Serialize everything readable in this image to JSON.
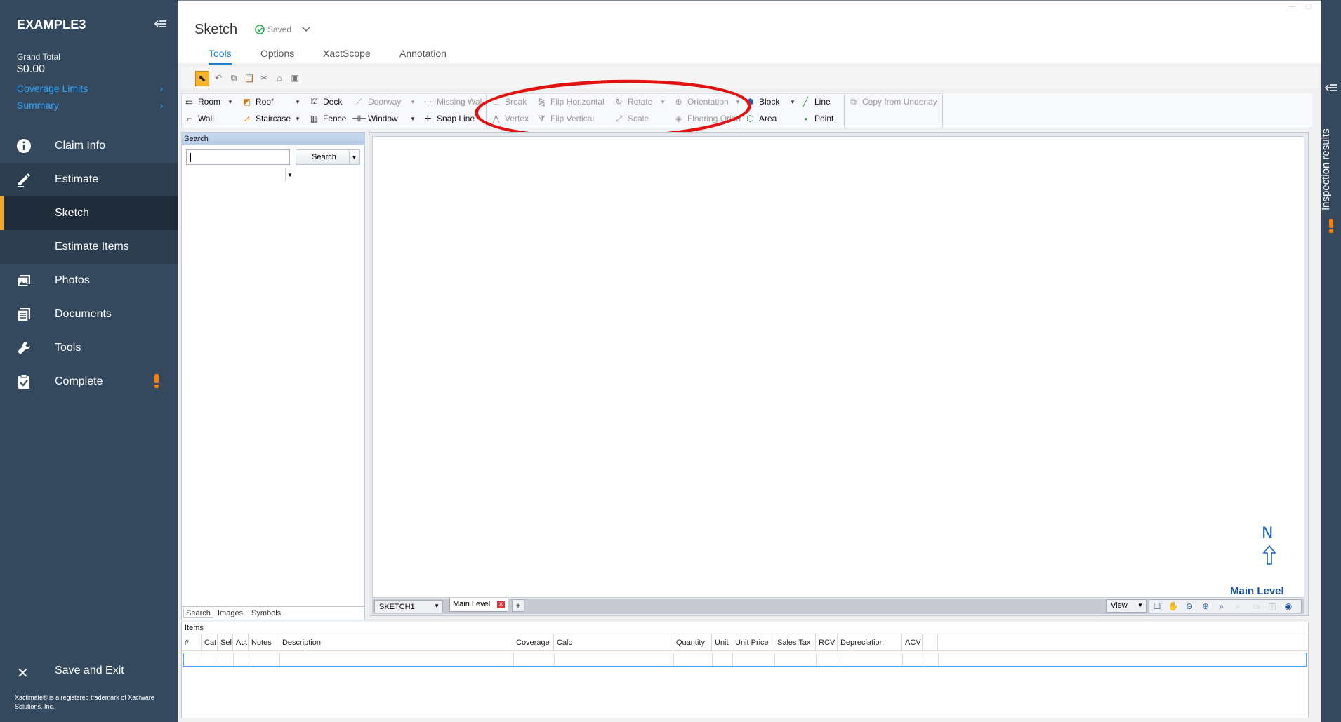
{
  "sidebar": {
    "brand": "EXAMPLE3",
    "grand_total_label": "Grand Total",
    "grand_total_value": "$0.00",
    "links": [
      "Coverage Limits",
      "Summary"
    ],
    "nav": {
      "claim_info": "Claim Info",
      "estimate": "Estimate",
      "sketch": "Sketch",
      "estimate_items": "Estimate Items",
      "photos": "Photos",
      "documents": "Documents",
      "tools": "Tools",
      "complete": "Complete"
    },
    "save_exit": "Save and Exit",
    "trademark": "Xactimate® is a registered trademark of Xactware Solutions, Inc."
  },
  "header": {
    "title": "Sketch",
    "status": "Saved",
    "tabs": [
      "Tools",
      "Options",
      "XactScope",
      "Annotation"
    ],
    "active_tab": "Tools"
  },
  "ribbon": {
    "room": "Room",
    "wall": "Wall",
    "roof": "Roof",
    "staircase": "Staircase",
    "deck": "Deck",
    "fence": "Fence",
    "doorway": "Doorway",
    "window": "Window",
    "missing_wall": "Missing Wal",
    "snap_line": "Snap Line",
    "break": "Break",
    "vertex": "Vertex",
    "flip_horizontal": "Flip Horizontal",
    "flip_vertical": "Flip Vertical",
    "rotate": "Rotate",
    "scale": "Scale",
    "orientation": "Orientation",
    "flooring": "Flooring Orien",
    "block": "Block",
    "area": "Area",
    "line": "Line",
    "point": "Point",
    "copy_underlay": "Copy from Underlay"
  },
  "search_panel": {
    "header": "Search",
    "input_value": "",
    "button": "Search",
    "tabs": [
      "Search",
      "Images",
      "Symbols"
    ]
  },
  "canvas": {
    "north": "N",
    "level_label": "Main Level",
    "sketch_name": "SKETCH1",
    "level_tab": "Main Level",
    "add_level": "+",
    "view": "View"
  },
  "items": {
    "header": "Items",
    "columns": [
      "#",
      "Cat",
      "Sel",
      "Act",
      "Notes",
      "Description",
      "Coverage",
      "Calc",
      "Quantity",
      "Unit",
      "Unit Price",
      "Sales Tax",
      "RCV",
      "Depreciation",
      "ACV"
    ]
  },
  "right_rail": {
    "label": "Inspection results"
  },
  "colors": {
    "sidebar_bg": "#34495e",
    "accent": "#1f7fd1",
    "alert": "#ff7f00",
    "highlight_ring": "#e31212",
    "selected_tool": "#f7b32b"
  }
}
